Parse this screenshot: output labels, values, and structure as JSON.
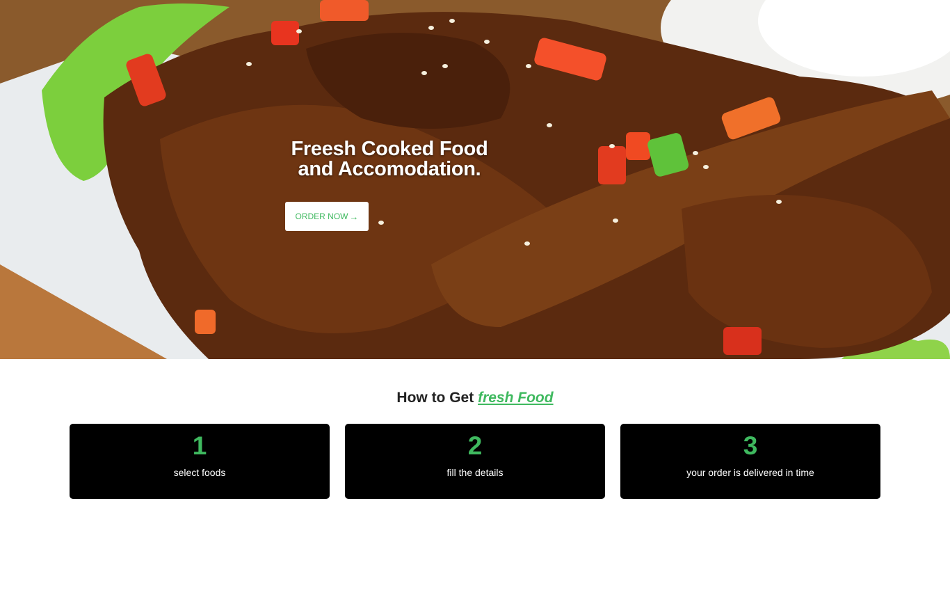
{
  "hero": {
    "title_line1": "Freesh Cooked Food",
    "title_line2": "and Accomodation.",
    "order_button_label": "ORDER NOW",
    "order_button_icon": "arrow-right-icon",
    "background_image": "grilled-meat-platter"
  },
  "how_to": {
    "heading_prefix": "How to Get ",
    "heading_accent": "fresh Food",
    "steps": [
      {
        "number": "1",
        "label": "select foods"
      },
      {
        "number": "2",
        "label": "fill the details"
      },
      {
        "number": "3",
        "label": "your order is delivered in time"
      }
    ]
  },
  "colors": {
    "accent_green": "#3fb95f",
    "card_bg": "#000000",
    "page_bg": "#ffffff"
  }
}
